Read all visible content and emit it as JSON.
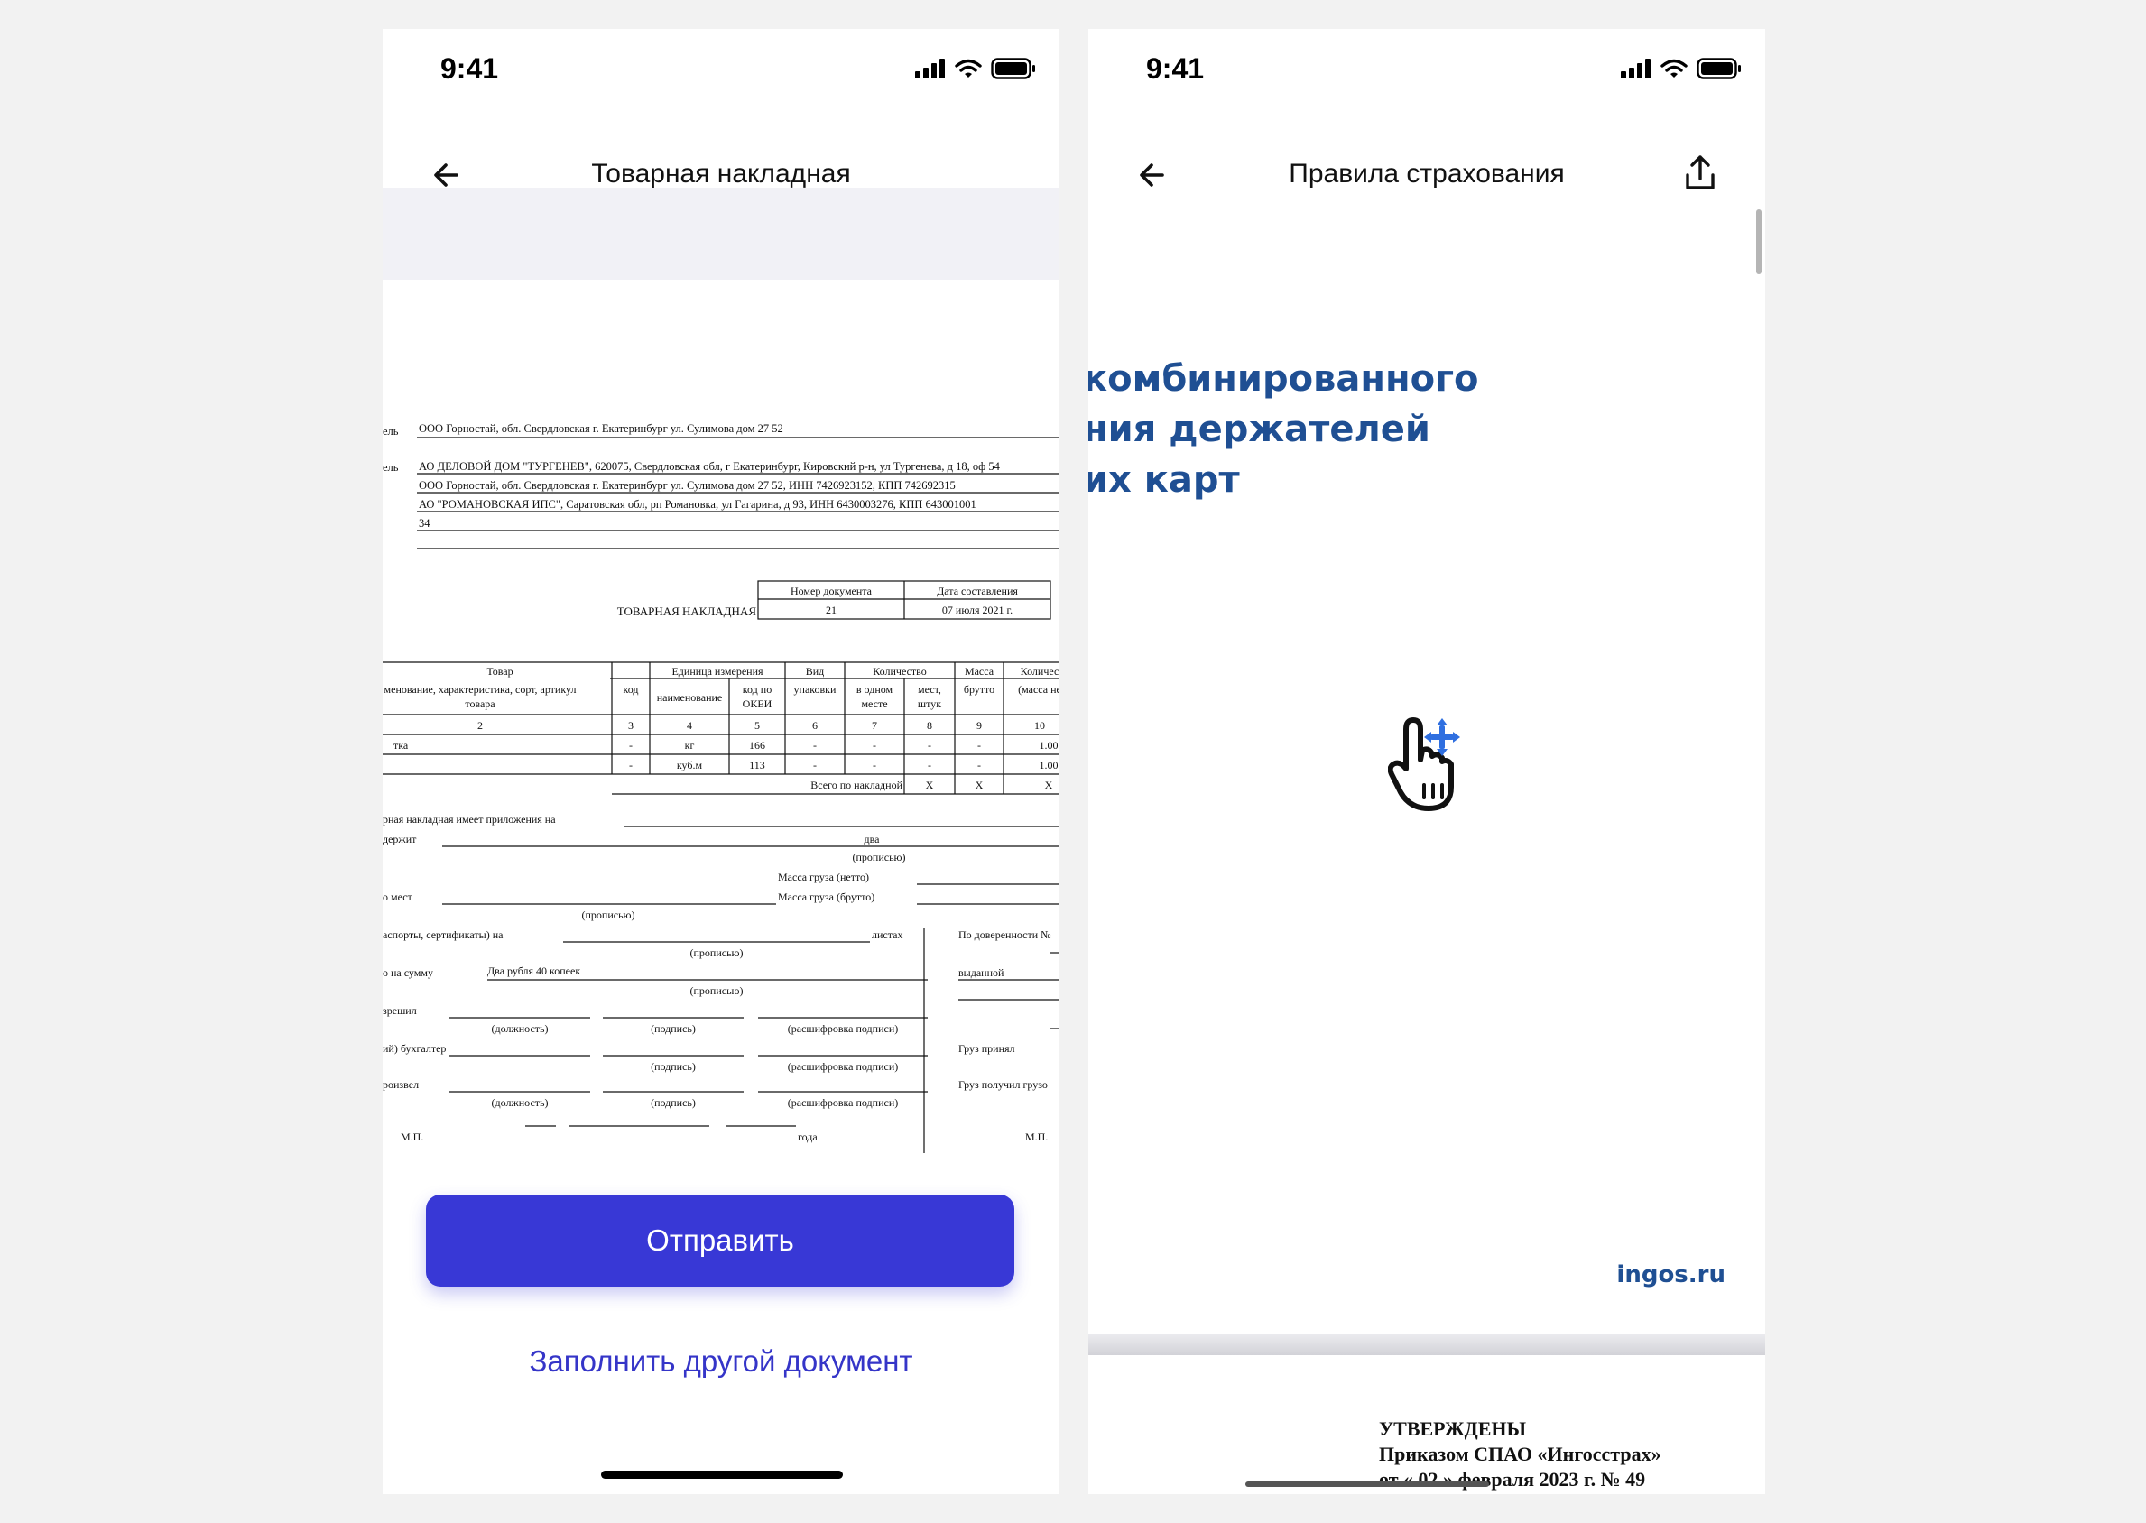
{
  "left_phone": {
    "time": "9:41",
    "title": "Товарная накладная",
    "send_button": "Отправить",
    "other_doc_link": "Заполнить другой документ",
    "invoice": {
      "header_rows": [
        {
          "cut_label": "ель",
          "text": "ООО Горностай, обл. Свердловская г. Екатеринбург ул. Сулимова дом 27 52"
        },
        {
          "cut_label": "ель",
          "text": "АО ДЕЛОВОЙ ДОМ \"ТУРГЕНЕВ\", 620075, Свердловская обл, г Екатеринбург, Кировский р-н, ул Тургенева, д 18, оф 54"
        },
        {
          "cut_label": "",
          "text": "ООО Горностай, обл. Свердловская г. Екатеринбург ул. Сулимова дом 27 52, ИНН 7426923152, КПП 742692315"
        },
        {
          "cut_label": "",
          "text": "АО \"РОМАНОВСКАЯ ИПС\", Саратовская обл, рп Романовка, ул Гагарина, д 93, ИНН 6430003276, КПП 643001001"
        },
        {
          "cut_label": "",
          "text": "34"
        }
      ],
      "doc_title": "ТОВАРНАЯ НАКЛАДНАЯ",
      "doc_number_label": "Номер документа",
      "doc_date_label": "Дата составления",
      "doc_number": "21",
      "doc_date": "07 июля 2021 г.",
      "table_groups": [
        "Товар",
        "Единица измерения",
        "Вид",
        "Количество",
        "Масса",
        "Количес"
      ],
      "table_subheaders": [
        "менование, характеристика, сорт, артикул",
        "товара",
        "код",
        "наименование",
        "код по",
        "ОКЕИ",
        "упаковки",
        "в одном",
        "месте",
        "мест,",
        "штук",
        "брутто",
        "(масса не"
      ],
      "col_numbers": [
        "2",
        "3",
        "4",
        "5",
        "6",
        "7",
        "8",
        "9",
        "10"
      ],
      "rows": [
        [
          "тка",
          "-",
          "кг",
          "166",
          "-",
          "-",
          "-",
          "-",
          "1.00"
        ],
        [
          "",
          "-",
          "куб.м",
          "113",
          "-",
          "-",
          "-",
          "-",
          "1.00"
        ]
      ],
      "total_label": "Всего по накладной",
      "total_values": [
        "X",
        "X",
        "X"
      ],
      "footer": {
        "appendix": "рная накладная имеет приложения на",
        "contains": "держит",
        "two": "два",
        "in_words": "(прописью)",
        "net_mass": "Масса груза (нетто)",
        "places": "о мест",
        "gross_mass": "Масса груза (брутто)",
        "passports": "аспорты, сертификаты) на",
        "sheets": "листах",
        "sum_label": "о на сумму",
        "sum_value": "Два рубля 40 копеек",
        "permitted": "зрешил",
        "position": "(должность)",
        "signature": "(подпись)",
        "decode": "(расшифровка подписи)",
        "accountant": "ий) бухгалтер",
        "released": "роизвел",
        "mp": "М.П.",
        "year": "года",
        "proxy": "По доверенности №",
        "issued": "выданной",
        "cargo_accepted": "Груз принял",
        "cargo_received": "Груз получил грузо"
      }
    }
  },
  "right_phone": {
    "time": "9:41",
    "title": "Правила страхования",
    "cover_lines": [
      "комбинированного",
      "ния держателей",
      "их карт"
    ],
    "site": "ingos.ru",
    "approved_lines": [
      "УТВЕРЖДЕНЫ",
      "Приказом СПАО «Ингосстрах»",
      "от « 02 » февраля 2023 г. № 49"
    ]
  },
  "colors": {
    "accent": "#3838d6",
    "link": "#3535c8",
    "brand_blue": "#1f4f93",
    "move_icon": "#2f6fe0",
    "page_bg": "#f2f2f2"
  },
  "icons": [
    "back-arrow-icon",
    "share-icon",
    "signal-icon",
    "wifi-icon",
    "battery-icon",
    "hand-move-icon"
  ]
}
